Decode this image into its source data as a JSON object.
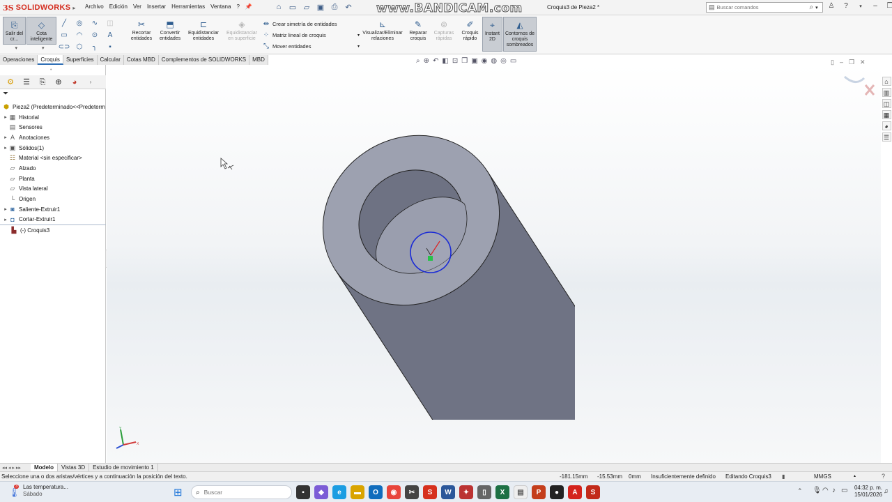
{
  "app": {
    "logo_ds": "3S",
    "logo_text": "SOLIDWORKS",
    "watermark": "www.BANDICAM.com",
    "document_title": "Croquis3 de Pieza2 *"
  },
  "menu": [
    "Archivo",
    "Edición",
    "Ver",
    "Insertar",
    "Herramientas",
    "Ventana",
    "?"
  ],
  "search": {
    "placeholder": "Buscar comandos"
  },
  "ribbon": {
    "exit_sketch": "Salir del cr...",
    "smart_dimension": "Cota inteligente",
    "trim": "Recortar entidades",
    "convert": "Convertir entidades",
    "offset": "Equidistanciar entidades",
    "offset_surface": "Equidistanciar en superficie",
    "mirror": "Crear simetría de entidades",
    "linear_pattern": "Matriz lineal de croquis",
    "move": "Mover entidades",
    "relations": "Visualizar/Eliminar relaciones",
    "repair": "Reparar croquis",
    "quick_snaps": "Capturas rápidas",
    "rapid_sketch": "Croquis rápido",
    "instant2d": "Instant 2D",
    "shaded_contours": "Contornos de croquis sombreados"
  },
  "tabs": [
    "Operaciones",
    "Croquis",
    "Superficies",
    "Calcular",
    "Cotas MBD",
    "Complementos de SOLIDWORKS",
    "MBD"
  ],
  "active_tab": "Croquis",
  "tree": {
    "root": "Pieza2  (Predeterminado<<Predeterm",
    "items": [
      {
        "label": "Historial",
        "expandable": true
      },
      {
        "label": "Sensores",
        "expandable": false
      },
      {
        "label": "Anotaciones",
        "expandable": true
      },
      {
        "label": "Sólidos(1)",
        "expandable": true
      },
      {
        "label": "Material <sin especificar>",
        "expandable": false
      },
      {
        "label": "Alzado",
        "expandable": false
      },
      {
        "label": "Planta",
        "expandable": false
      },
      {
        "label": "Vista lateral",
        "expandable": false
      },
      {
        "label": "Origen",
        "expandable": false
      },
      {
        "label": "Saliente-Extruir1",
        "expandable": true
      },
      {
        "label": "Cortar-Extruir1",
        "expandable": true
      },
      {
        "label": "(-) Croquis3",
        "expandable": false
      }
    ]
  },
  "bottom_tabs": [
    "Modelo",
    "Vistas 3D",
    "Estudio de movimiento 1"
  ],
  "status": {
    "message": "Seleccione una o dos aristas/vértices y a continuación la posición del texto.",
    "x": "-181.15mm",
    "y": "-15.53mm",
    "z": "0mm",
    "definition": "Insuficientemente definido",
    "editing": "Editando Croquis3",
    "units": "MMGS"
  },
  "taskbar": {
    "weather_title": "Las temperatura...",
    "weather_sub": "Sábado",
    "weather_badge": "3",
    "search_placeholder": "Buscar",
    "time": "04:32 p. m.",
    "date": "15/01/2026"
  },
  "colors": {
    "model_face": "#9da1b0",
    "model_side": "#6f7384",
    "sketch_circle": "#1a2bd6",
    "active_tab_underline": "#2f6fb5",
    "logo_red": "#d42c1e"
  }
}
